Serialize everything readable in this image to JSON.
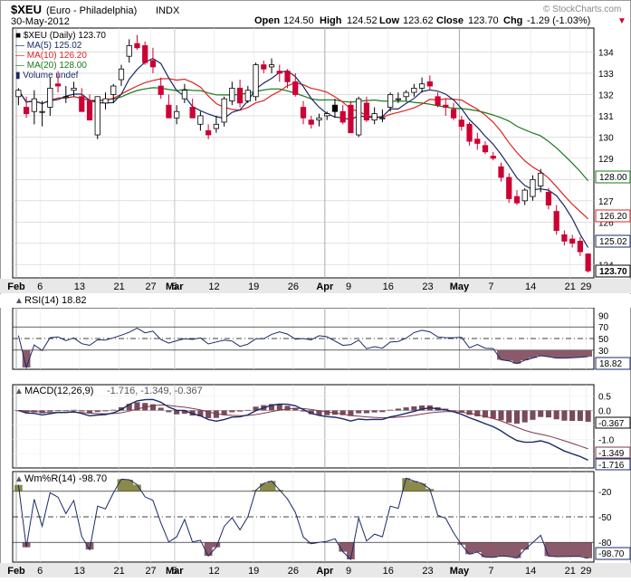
{
  "header": {
    "symbol": "$XEU",
    "name": "(Euro - Philadelphia)",
    "exchange": "INDX",
    "date": "30-May-2012",
    "watermark": "© StockCharts.com",
    "open_label": "Open",
    "open": "124.50",
    "high_label": "High",
    "high": "124.52",
    "low_label": "Low",
    "low": "123.62",
    "close_label": "Close",
    "close": "123.70",
    "chg_label": "Chg",
    "chg": "-1.29 (-1.03%)",
    "chg_arrow": "▼"
  },
  "colors": {
    "up_candle": "#ffffff",
    "down_candle": "#cc0033",
    "black_candle": "#000000",
    "ma5": "#1a2a66",
    "ma10": "#dd2222",
    "ma20": "#1a7a1a",
    "rsi_line": "#1a2a66",
    "indicator_fill": "#8a5a6a",
    "wr_fill_top": "#8a8a4a",
    "macd_hist": "#7a4a5a",
    "signal": "#7a3a4a",
    "grid": "#cccccc"
  },
  "legend": [
    {
      "text": "■ $XEU (Daily) 123.70",
      "color": "#000000"
    },
    {
      "text": "— MA(5) 125.02",
      "color": "#1a2a66"
    },
    {
      "text": "— MA(10) 126.20",
      "color": "#dd2222"
    },
    {
      "text": "— MA(20) 128.00",
      "color": "#1a7a1a"
    },
    {
      "text": "▮ Volume undef",
      "color": "#1a2a66"
    }
  ],
  "rsi_label": "RSI(14) 18.82",
  "macd_label_prefix": "MACD(12,26,9)",
  "macd_values": "-1.716, -1.349, -0.367",
  "wr_label": "Wm%R(14) -98.70",
  "price_badges": [
    {
      "value": "128.00",
      "color": "#1a7a1a"
    },
    {
      "value": "126.20",
      "color": "#dd2222"
    },
    {
      "value": "125.02",
      "color": "#1a2a66"
    },
    {
      "value": "123.70",
      "color": "#000000"
    }
  ],
  "rsi_badge": "18.82",
  "macd_badges": [
    {
      "value": "-0.367",
      "color": "#000000"
    },
    {
      "value": "-1.349",
      "color": "#7a3a4a"
    },
    {
      "value": "-1.716",
      "color": "#1a2a66"
    }
  ],
  "wr_badge": "-98.70",
  "chart_data": {
    "type": "candlestick",
    "price_ylim": [
      123.5,
      135
    ],
    "price_ticks": [
      "124",
      "125",
      "126",
      "127",
      "128",
      "129",
      "130",
      "131",
      "132",
      "133",
      "134"
    ],
    "rsi_ticks": [
      "90",
      "70",
      "50",
      "30",
      "10"
    ],
    "rsi_ylim": [
      0,
      100
    ],
    "macd_ticks": [
      "0.5",
      "0.0",
      "-0.5",
      "-1.0",
      "-1.5"
    ],
    "macd_ylim": [
      -1.9,
      0.8
    ],
    "wr_ticks": [
      "-20",
      "-50",
      "-80"
    ],
    "wr_ylim": [
      -100,
      0
    ],
    "x_labels": [
      "Feb",
      "6",
      "13",
      "21",
      "27",
      "Mar",
      "5",
      "12",
      "19",
      "26",
      "Apr",
      "9",
      "16",
      "23",
      "May",
      "7",
      "14",
      "21",
      "29"
    ],
    "candles": [
      {
        "o": 131.9,
        "h": 132.3,
        "l": 131.5,
        "c": 132.2
      },
      {
        "o": 131.4,
        "h": 131.9,
        "l": 130.9,
        "c": 131.1
      },
      {
        "o": 131.2,
        "h": 132.2,
        "l": 130.6,
        "c": 131.8
      },
      {
        "o": 131.2,
        "h": 131.7,
        "l": 130.5,
        "c": 131.2
      },
      {
        "o": 131.4,
        "h": 132.8,
        "l": 131.0,
        "c": 132.3
      },
      {
        "o": 132.5,
        "h": 133.1,
        "l": 132.1,
        "c": 132.4
      },
      {
        "o": 131.9,
        "h": 132.4,
        "l": 131.6,
        "c": 131.9
      },
      {
        "o": 132.2,
        "h": 132.6,
        "l": 131.9,
        "c": 132.3
      },
      {
        "o": 131.9,
        "h": 132.3,
        "l": 131.2,
        "c": 131.2
      },
      {
        "o": 131.7,
        "h": 132.0,
        "l": 131.1,
        "c": 130.8
      },
      {
        "o": 130.1,
        "h": 131.8,
        "l": 129.9,
        "c": 131.9
      },
      {
        "o": 131.6,
        "h": 132.1,
        "l": 131.3,
        "c": 131.8
      },
      {
        "o": 132.0,
        "h": 132.5,
        "l": 131.6,
        "c": 132.4
      },
      {
        "o": 132.7,
        "h": 133.4,
        "l": 132.4,
        "c": 133.2
      },
      {
        "o": 133.8,
        "h": 134.6,
        "l": 133.5,
        "c": 134.3
      },
      {
        "o": 134.4,
        "h": 134.8,
        "l": 134.1,
        "c": 134.2
      },
      {
        "o": 134.3,
        "h": 134.5,
        "l": 133.4,
        "c": 133.5
      },
      {
        "o": 133.6,
        "h": 134.2,
        "l": 133.0,
        "c": 133.3
      },
      {
        "o": 132.4,
        "h": 132.8,
        "l": 131.8,
        "c": 132.0
      },
      {
        "o": 131.5,
        "h": 132.0,
        "l": 131.0,
        "c": 130.9
      },
      {
        "o": 130.9,
        "h": 131.5,
        "l": 130.6,
        "c": 131.2
      },
      {
        "o": 131.8,
        "h": 132.5,
        "l": 131.6,
        "c": 132.2
      },
      {
        "o": 131.4,
        "h": 131.8,
        "l": 131.0,
        "c": 130.9
      },
      {
        "o": 130.6,
        "h": 131.2,
        "l": 130.3,
        "c": 131.0
      },
      {
        "o": 130.3,
        "h": 130.6,
        "l": 129.9,
        "c": 130.1
      },
      {
        "o": 130.4,
        "h": 131.0,
        "l": 130.2,
        "c": 130.6
      },
      {
        "o": 130.7,
        "h": 131.9,
        "l": 130.5,
        "c": 131.8
      },
      {
        "o": 131.7,
        "h": 132.6,
        "l": 131.5,
        "c": 132.3
      },
      {
        "o": 132.3,
        "h": 132.7,
        "l": 131.4,
        "c": 131.6
      },
      {
        "o": 131.7,
        "h": 132.4,
        "l": 131.6,
        "c": 132.2
      },
      {
        "o": 131.9,
        "h": 133.5,
        "l": 131.7,
        "c": 133.4
      },
      {
        "o": 133.4,
        "h": 133.6,
        "l": 133.0,
        "c": 133.2
      },
      {
        "o": 133.3,
        "h": 133.7,
        "l": 133.0,
        "c": 133.4
      },
      {
        "o": 133.1,
        "h": 133.4,
        "l": 132.6,
        "c": 133.0
      },
      {
        "o": 133.1,
        "h": 133.2,
        "l": 132.3,
        "c": 132.6
      },
      {
        "o": 132.6,
        "h": 133.0,
        "l": 131.9,
        "c": 132.0
      },
      {
        "o": 131.4,
        "h": 131.7,
        "l": 130.6,
        "c": 130.9
      },
      {
        "o": 130.8,
        "h": 131.0,
        "l": 130.4,
        "c": 130.6
      },
      {
        "o": 130.8,
        "h": 131.1,
        "l": 130.5,
        "c": 130.9
      },
      {
        "o": 131.0,
        "h": 131.2,
        "l": 130.8,
        "c": 131.1
      },
      {
        "o": 131.5,
        "h": 131.8,
        "l": 130.9,
        "c": 131.2,
        "black": true
      },
      {
        "o": 131.2,
        "h": 131.5,
        "l": 130.6,
        "c": 130.7
      },
      {
        "o": 131.5,
        "h": 131.7,
        "l": 130.2,
        "c": 130.2
      },
      {
        "o": 130.1,
        "h": 131.9,
        "l": 130.0,
        "c": 131.8
      },
      {
        "o": 131.6,
        "h": 131.9,
        "l": 130.7,
        "c": 130.8
      },
      {
        "o": 130.8,
        "h": 131.4,
        "l": 130.6,
        "c": 131.1
      },
      {
        "o": 130.9,
        "h": 131.3,
        "l": 130.7,
        "c": 130.9
      },
      {
        "o": 131.4,
        "h": 132.1,
        "l": 131.2,
        "c": 132.0
      },
      {
        "o": 131.8,
        "h": 132.1,
        "l": 131.6,
        "c": 131.8
      },
      {
        "o": 131.9,
        "h": 132.2,
        "l": 131.7,
        "c": 132.1
      },
      {
        "o": 132.1,
        "h": 132.5,
        "l": 131.9,
        "c": 132.3
      },
      {
        "o": 132.3,
        "h": 132.8,
        "l": 132.1,
        "c": 132.5
      },
      {
        "o": 132.6,
        "h": 132.9,
        "l": 132.2,
        "c": 132.4
      },
      {
        "o": 131.9,
        "h": 132.1,
        "l": 131.4,
        "c": 131.5
      },
      {
        "o": 131.5,
        "h": 131.8,
        "l": 131.0,
        "c": 131.4
      },
      {
        "o": 131.3,
        "h": 131.6,
        "l": 130.8,
        "c": 130.9
      },
      {
        "o": 130.8,
        "h": 131.0,
        "l": 130.3,
        "c": 130.5
      },
      {
        "o": 130.6,
        "h": 130.7,
        "l": 129.6,
        "c": 129.8
      },
      {
        "o": 129.9,
        "h": 130.2,
        "l": 129.4,
        "c": 129.7
      },
      {
        "o": 129.6,
        "h": 129.8,
        "l": 129.2,
        "c": 129.3
      },
      {
        "o": 129.1,
        "h": 129.3,
        "l": 128.9,
        "c": 129.0
      },
      {
        "o": 128.6,
        "h": 128.8,
        "l": 127.9,
        "c": 128.1
      },
      {
        "o": 128.1,
        "h": 128.3,
        "l": 126.9,
        "c": 127.1
      },
      {
        "o": 127.2,
        "h": 127.5,
        "l": 126.8,
        "c": 126.9
      },
      {
        "o": 127.0,
        "h": 127.6,
        "l": 126.8,
        "c": 127.5
      },
      {
        "o": 127.2,
        "h": 128.2,
        "l": 127.0,
        "c": 128.0
      },
      {
        "o": 127.7,
        "h": 128.5,
        "l": 127.4,
        "c": 128.3
      },
      {
        "o": 127.4,
        "h": 127.6,
        "l": 126.6,
        "c": 126.8
      },
      {
        "o": 126.5,
        "h": 126.8,
        "l": 125.4,
        "c": 125.6
      },
      {
        "o": 125.4,
        "h": 125.6,
        "l": 124.9,
        "c": 125.1
      },
      {
        "o": 125.2,
        "h": 125.4,
        "l": 124.8,
        "c": 125.0
      },
      {
        "o": 125.1,
        "h": 125.3,
        "l": 124.4,
        "c": 124.6
      },
      {
        "o": 124.5,
        "h": 124.52,
        "l": 123.62,
        "c": 123.7
      }
    ]
  }
}
